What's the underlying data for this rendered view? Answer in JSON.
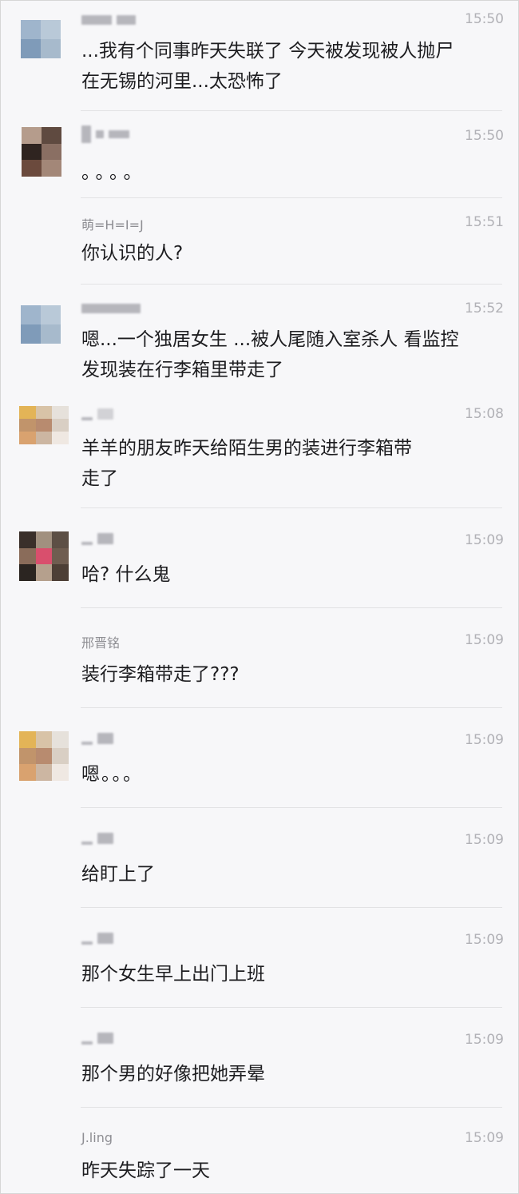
{
  "messages": [
    {
      "name": "",
      "time": "15:50",
      "text": "...我有个同事昨天失联了 今天被发现被人抛尸\n在无锡的河里...太恐怖了"
    },
    {
      "name": "",
      "time": "15:50",
      "text": "。。。。"
    },
    {
      "name": "萌=H=I=J",
      "time": "15:51",
      "text": "你认识的人?"
    },
    {
      "name": "",
      "time": "15:52",
      "text": "嗯...一个独居女生 ...被人尾随入室杀人 看监控\n发现装在行李箱里带走了"
    },
    {
      "name": "",
      "time": "15:08",
      "text": "羊羊的朋友昨天给陌生男的装进行李箱带\n走了"
    },
    {
      "name": "",
      "time": "15:09",
      "text": "哈? 什么鬼"
    },
    {
      "name": "邢晋铭",
      "time": "15:09",
      "text": "装行李箱带走了???"
    },
    {
      "name": "",
      "time": "15:09",
      "text": "嗯。。。"
    },
    {
      "name": "",
      "time": "15:09",
      "text": "给盯上了"
    },
    {
      "name": "",
      "time": "15:09",
      "text": "那个女生早上出门上班"
    },
    {
      "name": "",
      "time": "15:09",
      "text": "那个男的好像把她弄晕"
    },
    {
      "name": "J.ling",
      "time": "15:09",
      "text": "昨天失踪了一天"
    }
  ]
}
